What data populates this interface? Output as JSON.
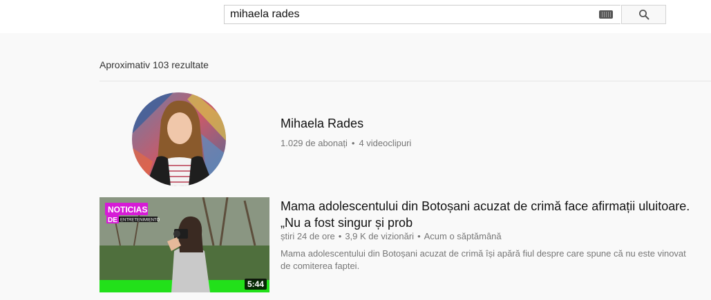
{
  "search": {
    "query": "mihaela rades",
    "keyboard_icon": "keyboard-icon",
    "button_icon": "search-icon"
  },
  "results": {
    "count_label": "Aproximativ 103 rezultate"
  },
  "channel": {
    "name": "Mihaela Rades",
    "subscribers": "1.029 de abonați",
    "videos": "4 videoclipuri"
  },
  "video": {
    "title": "Mama adolescentului din Botoșani acuzat de crimă face afirmații uluitoare. „Nu a fost singur și prob",
    "channel": "știri 24 de ore",
    "views": "3,9 K de vizionări",
    "age": "Acum o săptămână",
    "description": "Mama adolescentului din Botoșani acuzat de crimă își apără fiul despre care spune că nu este vinovat de comiterea faptei.",
    "duration": "5:44",
    "thumbnail_badge_main": "NOTICIAS",
    "thumbnail_badge_de": "DE",
    "thumbnail_badge_sub": "ENTRETENIMIENTO"
  },
  "colors": {
    "page_bg": "#f9f9f9",
    "topbar_bg": "#ffffff",
    "meta_text": "#767676",
    "badge_magenta": "#d61bd6",
    "thumb_green": "#22e01a"
  }
}
